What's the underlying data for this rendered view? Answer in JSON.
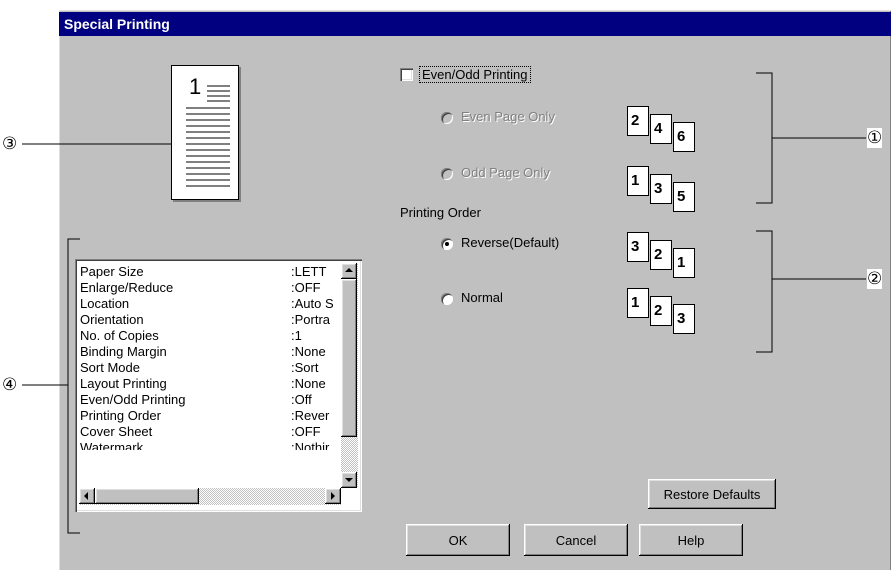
{
  "dialog": {
    "title": "Special Printing"
  },
  "even_odd": {
    "checkbox_label": "Even/Odd Printing",
    "checked": false,
    "options": [
      {
        "label": "Even Page Only",
        "pages": [
          "2",
          "4",
          "6"
        ]
      },
      {
        "label": "Odd Page Only",
        "pages": [
          "1",
          "3",
          "5"
        ]
      }
    ]
  },
  "printing_order": {
    "label": "Printing Order",
    "options": [
      {
        "label": "Reverse(Default)",
        "selected": true,
        "pages": [
          "3",
          "2",
          "1"
        ]
      },
      {
        "label": "Normal",
        "selected": false,
        "pages": [
          "1",
          "2",
          "3"
        ]
      }
    ]
  },
  "preview": {
    "page_number": "1"
  },
  "settings_list": [
    {
      "key": "Paper Size",
      "value": ":LETT"
    },
    {
      "key": "Enlarge/Reduce",
      "value": ":OFF"
    },
    {
      "key": "Location",
      "value": ":Auto S"
    },
    {
      "key": "Orientation",
      "value": ":Portra"
    },
    {
      "key": "No. of Copies",
      "value": ":1"
    },
    {
      "key": "Binding Margin",
      "value": ":None"
    },
    {
      "key": "Sort Mode",
      "value": ":Sort"
    },
    {
      "key": "Layout Printing",
      "value": ":None"
    },
    {
      "key": "Even/Odd Printing",
      "value": ":Off"
    },
    {
      "key": "Printing Order",
      "value": ":Rever"
    },
    {
      "key": "Cover Sheet",
      "value": ":OFF"
    },
    {
      "key": "Watermark",
      "value": ":Nothir"
    }
  ],
  "buttons": {
    "restore_defaults": "Restore Defaults",
    "ok": "OK",
    "cancel": "Cancel",
    "help": "Help"
  },
  "callouts": [
    "①",
    "②",
    "③",
    "④"
  ]
}
